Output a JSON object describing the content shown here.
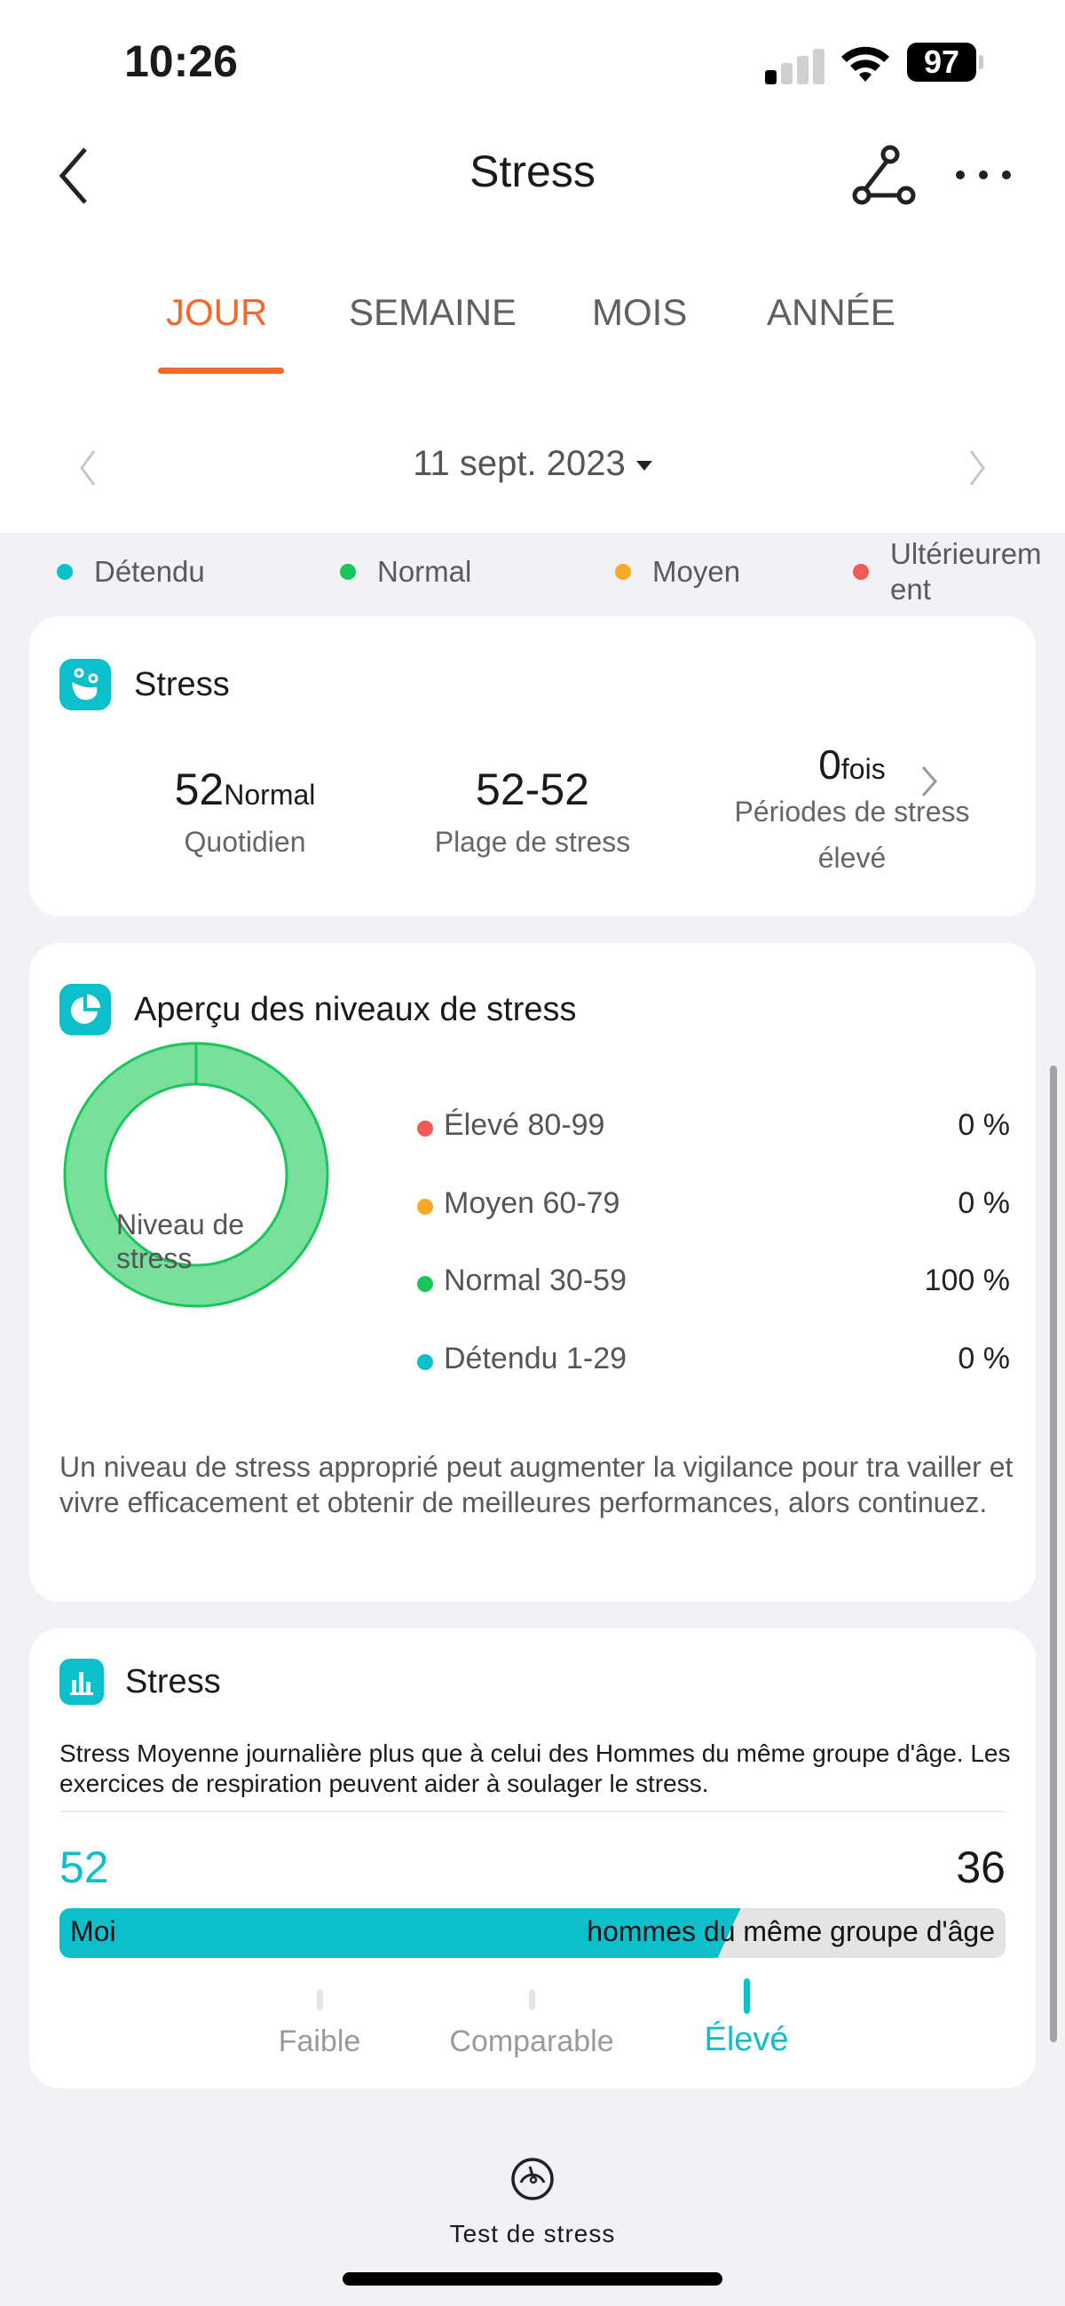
{
  "statusbar": {
    "time": "10:26",
    "battery": "97",
    "signal_bars_active": 1,
    "signal_bars_total": 4
  },
  "navbar": {
    "title": "Stress",
    "back_icon": "chevron-left-icon",
    "share_icon": "share-nodes-icon",
    "more_icon": "more-dots-icon"
  },
  "tabs": [
    {
      "label": "JOUR",
      "active": true
    },
    {
      "label": "SEMAINE",
      "active": false
    },
    {
      "label": "MOIS",
      "active": false
    },
    {
      "label": "ANNÉE",
      "active": false
    }
  ],
  "date": {
    "label": "11 sept. 2023"
  },
  "legend": [
    {
      "label": "Détendu",
      "color": "#0bbfcb"
    },
    {
      "label": "Normal",
      "color": "#1ac55a"
    },
    {
      "label": "Moyen",
      "color": "#fca827"
    },
    {
      "label": "Ultérieurem ent",
      "line1": "Ultérieurem",
      "line2": "ent",
      "color": "#f25a55"
    }
  ],
  "summary_card": {
    "title": "Stress",
    "stats": [
      {
        "value": "52",
        "unit": "Normal",
        "label": "Quotidien"
      },
      {
        "value": "52-52",
        "unit": "",
        "label": "Plage de stress"
      },
      {
        "value": "0",
        "unit": "fois",
        "label_line1": "Périodes de stress",
        "label_line2": "élevé"
      }
    ]
  },
  "overview_card": {
    "title": "Aperçu des niveaux de stress",
    "donut_center_line1": "Niveau de",
    "donut_center_line2": "stress",
    "levels": [
      {
        "name": "Élevé 80-99",
        "percent_label": "0 %",
        "percent": 0,
        "color": "#f25a55"
      },
      {
        "name": "Moyen 60-79",
        "percent_label": "0 %",
        "percent": 0,
        "color": "#fca827"
      },
      {
        "name": "Normal 30-59",
        "percent_label": "100 %",
        "percent": 100,
        "color": "#1ac55a"
      },
      {
        "name": "Détendu 1-29",
        "percent_label": "0 %",
        "percent": 0,
        "color": "#0bbfcb"
      }
    ],
    "description": "Un niveau de stress approprié peut augmenter la vigilance pour tra vailler et vivre efficacement et obtenir de meilleures performances, alors continuez."
  },
  "compare_card": {
    "title": "Stress",
    "text": "Stress Moyenne journalière plus que à celui des Hommes du même groupe d'âge. Les exercices de respiration peuvent aider à soulager le stress.",
    "me_value": "52",
    "peer_value": "36",
    "me_label": "Moi",
    "peer_label": "hommes du même groupe d'âge",
    "me_share": 0.72,
    "scale": [
      {
        "label": "Faible",
        "active": false
      },
      {
        "label": "Comparable",
        "active": false
      },
      {
        "label": "Élevé",
        "active": true
      }
    ]
  },
  "footer": {
    "test_label": "Test de stress",
    "icon": "gauge-icon"
  },
  "colors": {
    "accent": "#f2692b",
    "teal": "#0bbfcb",
    "green": "#1ac55a",
    "bg": "#f1f2f6"
  }
}
